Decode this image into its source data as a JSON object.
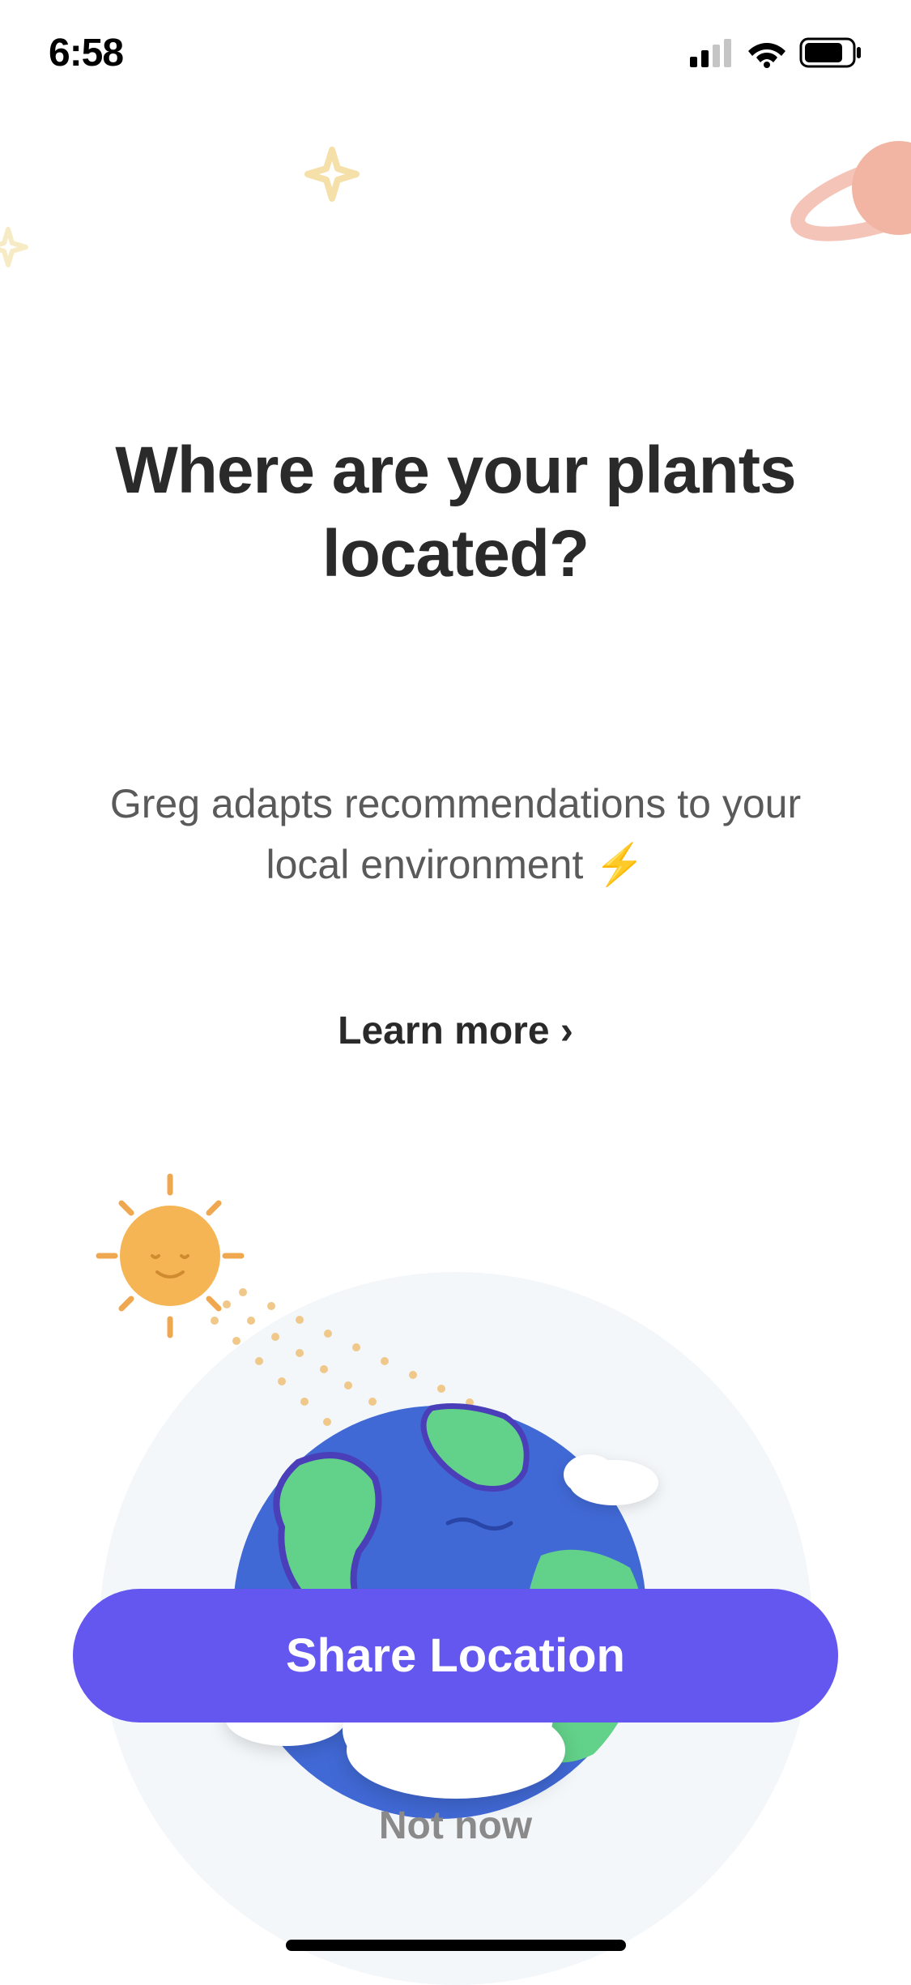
{
  "status_bar": {
    "time": "6:58"
  },
  "header": {
    "title": "Where are your plants located?",
    "subtitle": "Greg adapts recommendations to your local environment ⚡",
    "learn_more": "Learn more ›"
  },
  "buttons": {
    "primary": "Share Location",
    "secondary": "Not now"
  }
}
